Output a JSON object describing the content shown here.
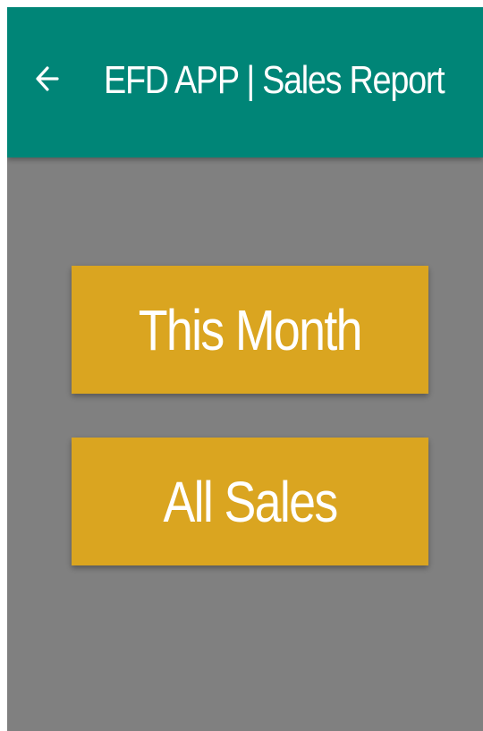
{
  "app_bar": {
    "back_icon": "arrow-left-icon",
    "title": "EFD APP | Sales Report",
    "background_color": "#008577",
    "text_color": "#FFFFFF"
  },
  "content": {
    "background_color": "#808080",
    "buttons": [
      {
        "label": "This Month",
        "color": "#DAA520"
      },
      {
        "label": "All Sales",
        "color": "#DAA520"
      }
    ]
  }
}
